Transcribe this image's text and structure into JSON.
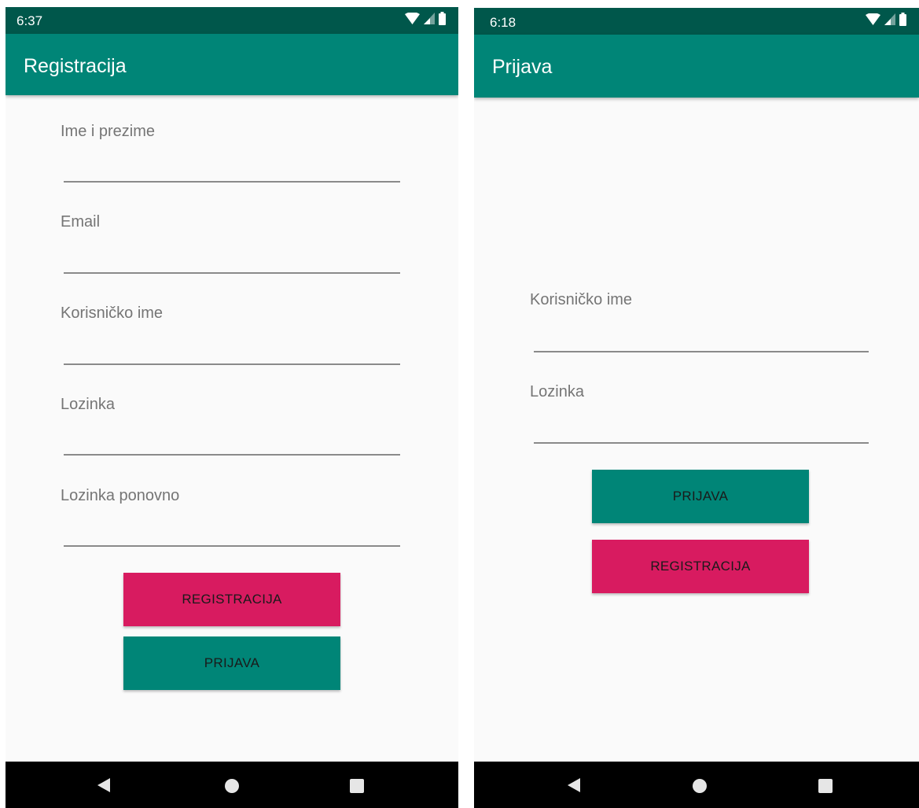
{
  "registration_screen": {
    "status_time": "6:37",
    "title": "Registracija",
    "fields": [
      {
        "label": "Ime i prezime",
        "value": ""
      },
      {
        "label": "Email",
        "value": ""
      },
      {
        "label": "Korisničko ime",
        "value": ""
      },
      {
        "label": "Lozinka",
        "value": ""
      },
      {
        "label": "Lozinka ponovno",
        "value": ""
      }
    ],
    "register_button": "REGISTRACIJA",
    "login_button": "PRIJAVA"
  },
  "login_screen": {
    "status_time": "6:18",
    "title": "Prijava",
    "fields": [
      {
        "label": "Korisničko ime",
        "value": ""
      },
      {
        "label": "Lozinka",
        "value": ""
      }
    ],
    "login_button": "PRIJAVA",
    "register_button": "REGISTRACIJA"
  },
  "status_icons": [
    "wifi-icon",
    "cell-signal-icon",
    "battery-icon"
  ],
  "nav_icons": [
    "back-icon",
    "home-icon",
    "recents-icon"
  ],
  "colors": {
    "primary": "#008577",
    "primary_dark": "#00574b",
    "accent": "#d81b60",
    "background": "#fafafa",
    "hint_text": "#757575"
  }
}
